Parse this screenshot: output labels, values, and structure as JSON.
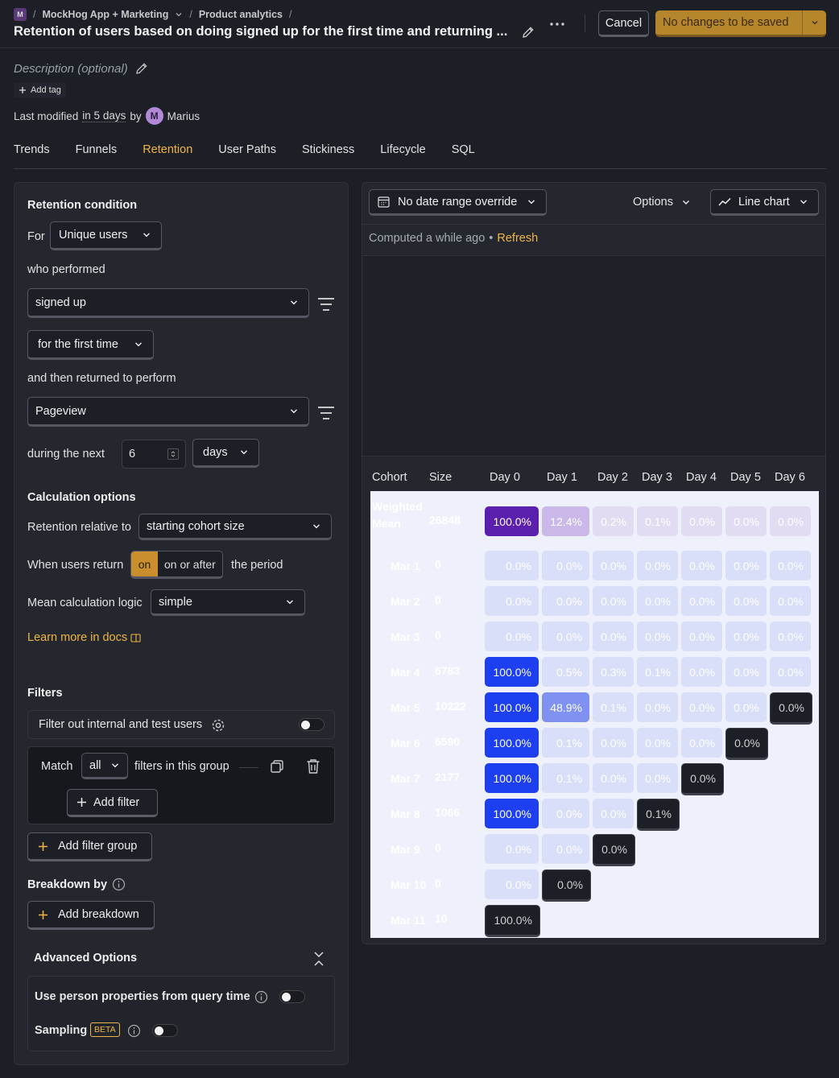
{
  "breadcrumb": {
    "logo": "M",
    "project": "MockHog App + Marketing",
    "section": "Product analytics"
  },
  "title": "Retention of users based on doing signed up for the first time and returning ...",
  "header": {
    "cancel_label": "Cancel",
    "save_label": "No changes to be saved"
  },
  "meta": {
    "description_placeholder": "Description (optional)",
    "add_tag": "Add tag",
    "last_modified_prefix": "Last modified",
    "last_modified_time": "in 5 days",
    "by": "by",
    "user": "Marius",
    "user_initial": "M"
  },
  "tabs": [
    "Trends",
    "Funnels",
    "Retention",
    "User Paths",
    "Stickiness",
    "Lifecycle",
    "SQL"
  ],
  "active_tab": "Retention",
  "left": {
    "retention_condition": "Retention condition",
    "for": "For",
    "unique_users": "Unique users",
    "who_performed": "who performed",
    "event1": "signed up",
    "first_time": "for the first time",
    "returned_to_perform": "and then returned to perform",
    "event2": "Pageview",
    "during_next": "during the next",
    "period_count": "6",
    "period_unit": "days",
    "calc_options": "Calculation options",
    "retention_relative": "Retention relative to",
    "starting_cohort": "starting cohort size",
    "when_return": "When users return",
    "on": "on",
    "on_or_after": "on or after",
    "the_period": "the period",
    "mean_logic": "Mean calculation logic",
    "simple": "simple",
    "learn_more": "Learn more in docs",
    "filters": "Filters",
    "filter_internal": "Filter out internal and test users",
    "match": "Match",
    "all": "all",
    "filters_in_group": "filters in this group",
    "add_filter": "Add filter",
    "add_filter_group": "Add filter group",
    "breakdown_by": "Breakdown by",
    "add_breakdown": "Add breakdown",
    "advanced_options": "Advanced Options",
    "person_props": "Use person properties from query time",
    "sampling": "Sampling",
    "beta": "BETA"
  },
  "right": {
    "date_range": "No date range override",
    "options": "Options",
    "chart_type": "Line chart",
    "computed": "Computed a while ago",
    "bullet": "•",
    "refresh": "Refresh"
  },
  "table": {
    "headers": [
      "Cohort",
      "Size",
      "Day 0",
      "Day 1",
      "Day 2",
      "Day 3",
      "Day 4",
      "Day 5",
      "Day 6"
    ],
    "rows": [
      {
        "cohort": "Weighted Mean",
        "size": "26848",
        "values": [
          "100.0%",
          "12.4%",
          "0.2%",
          "0.1%",
          "0.0%",
          "0.0%",
          "0.0%"
        ]
      },
      {
        "cohort": "Mar 1",
        "size": "0",
        "values": [
          "0.0%",
          "0.0%",
          "0.0%",
          "0.0%",
          "0.0%",
          "0.0%",
          "0.0%"
        ]
      },
      {
        "cohort": "Mar 2",
        "size": "0",
        "values": [
          "0.0%",
          "0.0%",
          "0.0%",
          "0.0%",
          "0.0%",
          "0.0%",
          "0.0%"
        ]
      },
      {
        "cohort": "Mar 3",
        "size": "0",
        "values": [
          "0.0%",
          "0.0%",
          "0.0%",
          "0.0%",
          "0.0%",
          "0.0%",
          "0.0%"
        ]
      },
      {
        "cohort": "Mar 4",
        "size": "6783",
        "values": [
          "100.0%",
          "0.5%",
          "0.3%",
          "0.1%",
          "0.0%",
          "0.0%",
          "0.0%"
        ]
      },
      {
        "cohort": "Mar 5",
        "size": "10222",
        "values": [
          "100.0%",
          "48.9%",
          "0.1%",
          "0.0%",
          "0.0%",
          "0.0%",
          "0.0%"
        ]
      },
      {
        "cohort": "Mar 6",
        "size": "6590",
        "values": [
          "100.0%",
          "0.1%",
          "0.0%",
          "0.0%",
          "0.0%",
          "0.0%"
        ]
      },
      {
        "cohort": "Mar 7",
        "size": "2177",
        "values": [
          "100.0%",
          "0.1%",
          "0.0%",
          "0.0%",
          "0.0%"
        ]
      },
      {
        "cohort": "Mar 8",
        "size": "1066",
        "values": [
          "100.0%",
          "0.0%",
          "0.0%",
          "0.1%"
        ]
      },
      {
        "cohort": "Mar 9",
        "size": "0",
        "values": [
          "0.0%",
          "0.0%",
          "0.0%"
        ]
      },
      {
        "cohort": "Mar 10",
        "size": "0",
        "values": [
          "0.0%",
          "0.0%"
        ]
      },
      {
        "cohort": "Mar 11",
        "size": "10",
        "values": [
          "100.0%"
        ]
      }
    ]
  },
  "colors": {
    "accent": "#f0b544",
    "save_bg": "#b6862d",
    "cell_full": "#1e3ff0",
    "cell_mean_full": "#5b1fae"
  }
}
